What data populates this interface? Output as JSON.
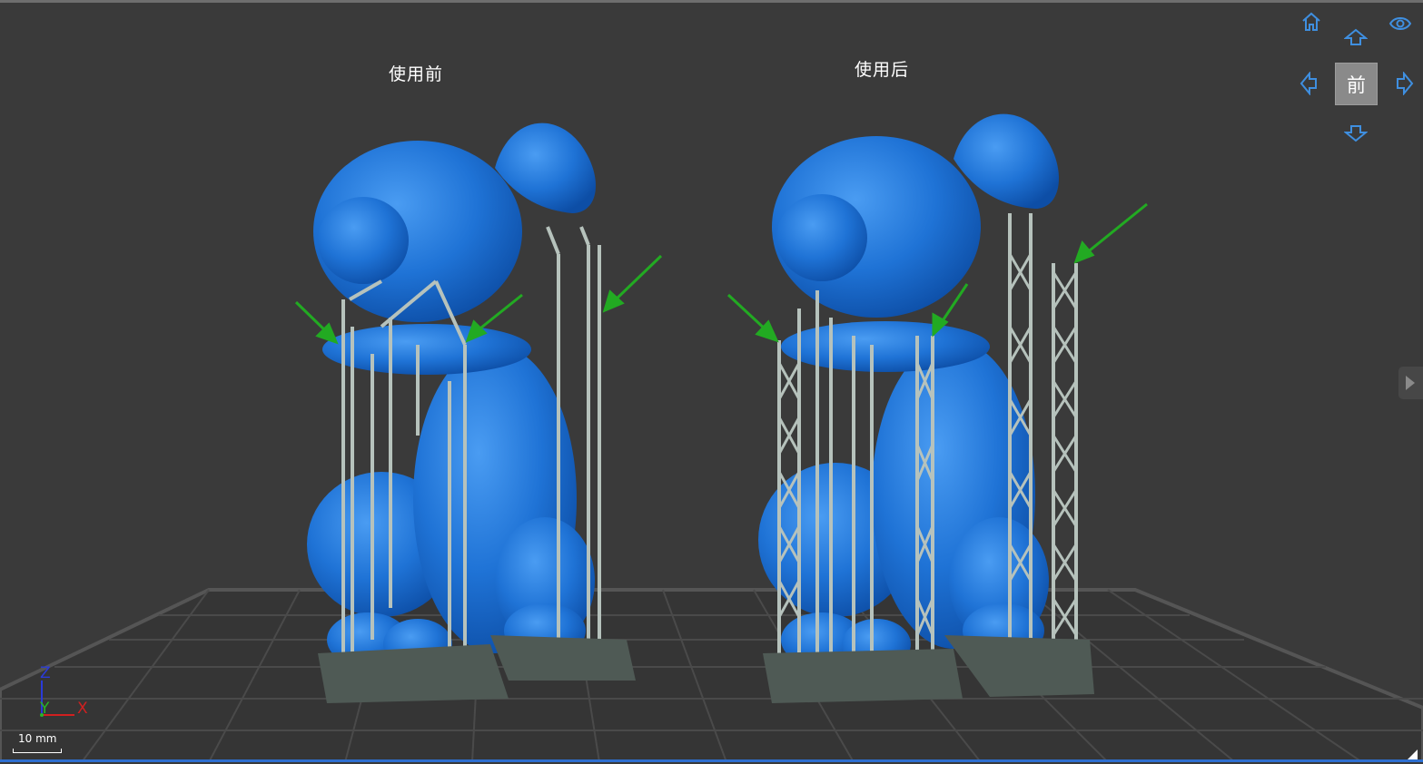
{
  "labels": {
    "before": "使用前",
    "after": "使用后"
  },
  "view_cube": {
    "front_label": "前",
    "icons": [
      "home-icon",
      "eye-icon",
      "arrow-up-icon",
      "arrow-left-icon",
      "arrow-right-icon",
      "arrow-down-icon"
    ]
  },
  "axis": {
    "z": "Z",
    "y": "Y",
    "x": "X"
  },
  "scale_bar": {
    "text": "10 mm"
  },
  "colors": {
    "background": "#3a3a3a",
    "model": "#1f73d6",
    "support": "#b6c2bc",
    "arrow": "#22aa22",
    "nav_icon": "#3f8fe0"
  }
}
